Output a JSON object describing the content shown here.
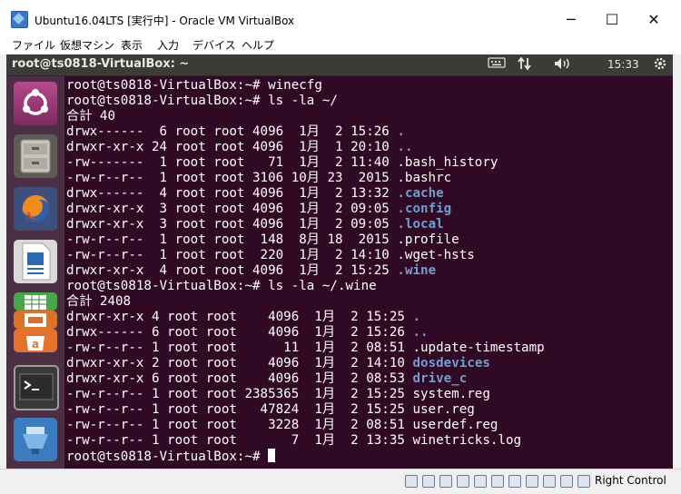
{
  "window": {
    "title": "Ubuntu16.04LTS [実行中] - Oracle VM VirtualBox",
    "minimize_glyph": "─",
    "maximize_glyph": "☐",
    "close_glyph": "✕"
  },
  "menubar": {
    "items": [
      "ファイル",
      "仮想マシン",
      "表示",
      "入力",
      "デバイス",
      "ヘルプ"
    ]
  },
  "panel": {
    "title": "root@ts0818-VirtualBox: ~",
    "clock": "15:33",
    "icons": [
      "keyboard-icon",
      "network-icon",
      "volume-icon",
      "power-gear-icon"
    ]
  },
  "launcher": {
    "items": [
      "ubuntu-dash-icon",
      "files-icon",
      "firefox-icon",
      "libreoffice-writer-icon",
      "libreoffice-calc-icon",
      "libreoffice-impress-icon",
      "software-center-icon",
      "terminal-icon",
      "system-settings-icon"
    ]
  },
  "terminal": {
    "lines": [
      [
        {
          "t": "root@ts0818-VirtualBox:~# winecfg"
        }
      ],
      [
        {
          "t": "root@ts0818-VirtualBox:~# ls -la ~/"
        }
      ],
      [
        {
          "t": "合計 40"
        }
      ],
      [
        {
          "t": "drwx------  6 root root 4096  1月  2 15:26 "
        },
        {
          "t": ".",
          "c": "dir"
        }
      ],
      [
        {
          "t": "drwxr-xr-x 24 root root 4096  1月  1 20:10 "
        },
        {
          "t": "..",
          "c": "dir"
        }
      ],
      [
        {
          "t": "-rw-------  1 root root   71  1月  2 11:40 .bash_history"
        }
      ],
      [
        {
          "t": "-rw-r--r--  1 root root 3106 10月 23  2015 .bashrc"
        }
      ],
      [
        {
          "t": "drwx------  4 root root 4096  1月  2 13:32 "
        },
        {
          "t": ".cache",
          "c": "dir"
        }
      ],
      [
        {
          "t": "drwxr-xr-x  3 root root 4096  1月  2 09:05 "
        },
        {
          "t": ".config",
          "c": "dir"
        }
      ],
      [
        {
          "t": "drwxr-xr-x  3 root root 4096  1月  2 09:05 "
        },
        {
          "t": ".local",
          "c": "dir"
        }
      ],
      [
        {
          "t": "-rw-r--r--  1 root root  148  8月 18  2015 .profile"
        }
      ],
      [
        {
          "t": "-rw-r--r--  1 root root  220  1月  2 14:10 .wget-hsts"
        }
      ],
      [
        {
          "t": "drwxr-xr-x  4 root root 4096  1月  2 15:25 "
        },
        {
          "t": ".wine",
          "c": "dir"
        }
      ],
      [
        {
          "t": "root@ts0818-VirtualBox:~# ls -la ~/.wine"
        }
      ],
      [
        {
          "t": "合計 2408"
        }
      ],
      [
        {
          "t": "drwxr-xr-x 4 root root    4096  1月  2 15:25 "
        },
        {
          "t": ".",
          "c": "dir"
        }
      ],
      [
        {
          "t": "drwx------ 6 root root    4096  1月  2 15:26 "
        },
        {
          "t": "..",
          "c": "dir"
        }
      ],
      [
        {
          "t": "-rw-r--r-- 1 root root      11  1月  2 08:51 .update-timestamp"
        }
      ],
      [
        {
          "t": "drwxr-xr-x 2 root root    4096  1月  2 14:10 "
        },
        {
          "t": "dosdevices",
          "c": "dir"
        }
      ],
      [
        {
          "t": "drwxr-xr-x 6 root root    4096  1月  2 08:53 "
        },
        {
          "t": "drive_c",
          "c": "dir"
        }
      ],
      [
        {
          "t": "-rw-r--r-- 1 root root 2385365  1月  2 15:25 system.reg"
        }
      ],
      [
        {
          "t": "-rw-r--r-- 1 root root   47824  1月  2 15:25 user.reg"
        }
      ],
      [
        {
          "t": "-rw-r--r-- 1 root root    3228  1月  2 08:51 userdef.reg"
        }
      ],
      [
        {
          "t": "-rw-r--r-- 1 root root       7  1月  2 13:35 winetricks.log"
        }
      ],
      [
        {
          "t": "root@ts0818-VirtualBox:~# "
        },
        {
          "t": "",
          "c": "cursor"
        }
      ]
    ]
  },
  "statusbar": {
    "icons": [
      "hard-disk-icon",
      "optical-drive-icon",
      "audio-icon",
      "network-adapter-icon",
      "usb-icon",
      "shared-folder-icon",
      "display-icon",
      "video-capture-icon",
      "cpu-icon",
      "mouse-integration-icon",
      "host-key-arrow-icon"
    ],
    "host_key": "Right Control"
  }
}
